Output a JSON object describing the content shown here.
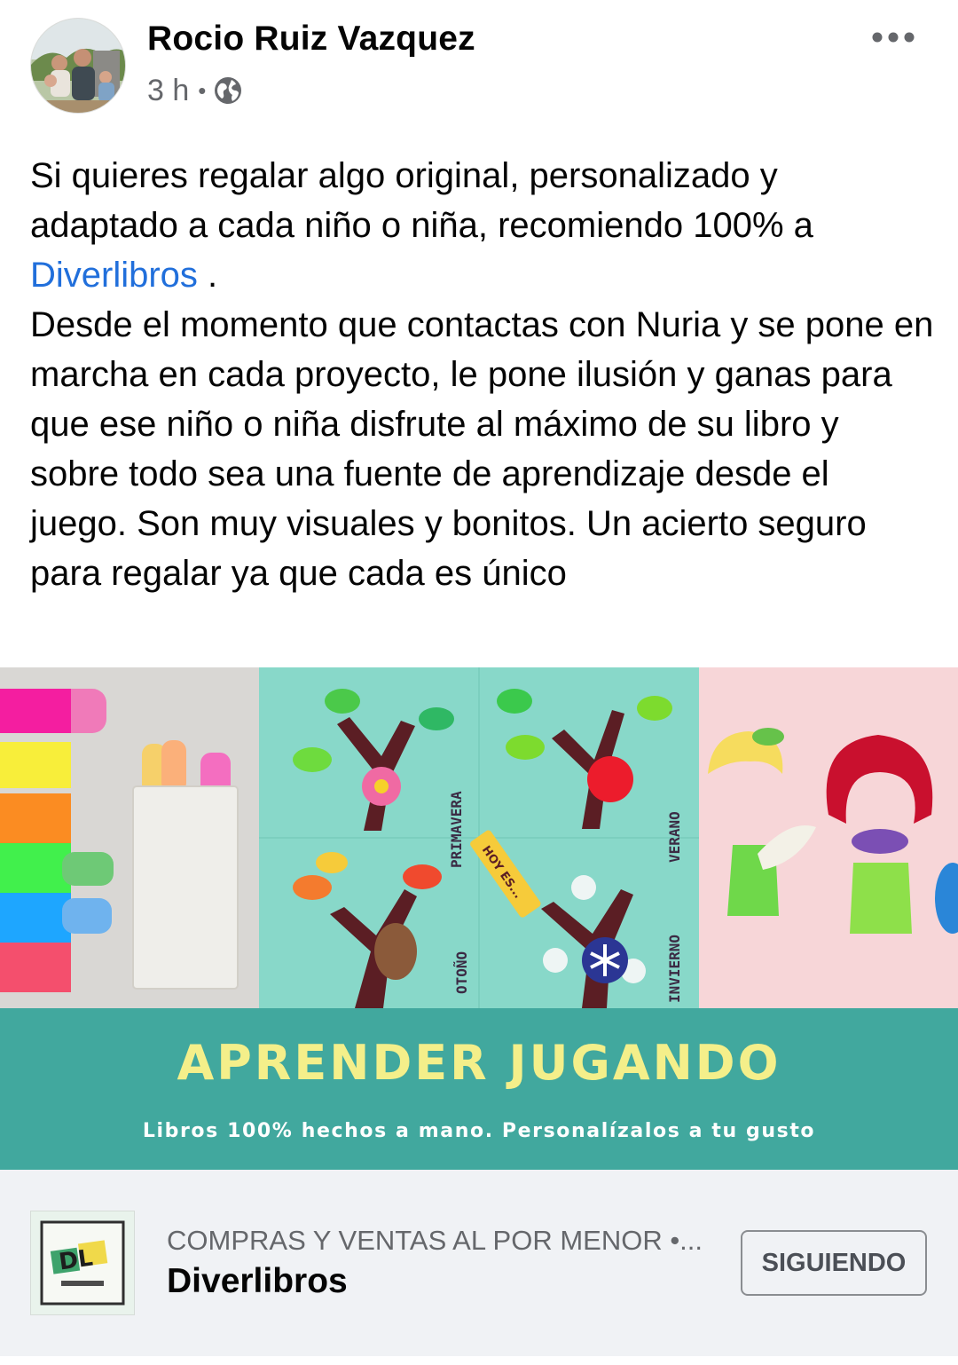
{
  "post": {
    "author": "Rocio Ruiz Vazquez",
    "time": "3 h",
    "separator": "•",
    "privacy_icon": "globe-icon",
    "more_icon": "more-horizontal-icon",
    "text_intro": "Si quieres regalar algo original, personalizado y adaptado a cada niño o niña, recomiendo 100% a ",
    "mention": "Diverlibros",
    "text_after_mention": " .",
    "text_body": "Desde el momento que contactas con Nuria y se pone en marcha en cada proyecto, le pone ilusión y ganas para que ese niño o niña disfrute al máximo de su libro y sobre todo sea una fuente de aprendizaje desde el juego. Son muy visuales y bonitos. Un acierto seguro para regalar ya que cada es único"
  },
  "image": {
    "seasons": [
      "PRIMAVERA",
      "VERANO",
      "OTOÑO",
      "INVIERNO"
    ],
    "tag_text": "HOY ES...",
    "banner_title": "APRENDER JUGANDO",
    "banner_subtitle": "Libros 100% hechos a mano. Personalízalos a tu gusto",
    "banner_color": "#41a89e",
    "banner_title_color": "#f4ef8a"
  },
  "page_card": {
    "category": "COMPRAS Y VENTAS AL POR MENOR •...",
    "name": "Diverlibros",
    "logo_text": "DL",
    "button_label": "SIGUIENDO"
  },
  "colors": {
    "link": "#216fdb",
    "secondary_text": "#65676b",
    "footer_bg": "#f0f2f5"
  }
}
